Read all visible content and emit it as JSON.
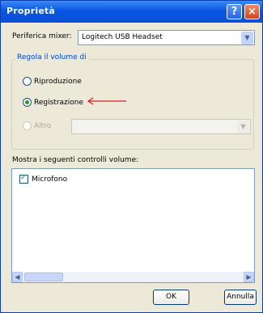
{
  "window": {
    "title": "Proprietà"
  },
  "titlebar": {
    "help_glyph": "?",
    "close_glyph": "×"
  },
  "mixer": {
    "label": "Periferica mixer:",
    "value": "Logitech USB Headset"
  },
  "volume_group": {
    "legend": "Regola il volume di",
    "options": [
      {
        "label": "Riproduzione",
        "checked": false,
        "enabled": true
      },
      {
        "label": "Registrazione",
        "checked": true,
        "enabled": true
      },
      {
        "label": "Altro",
        "checked": false,
        "enabled": false
      }
    ]
  },
  "controls": {
    "label": "Mostra i seguenti controlli volume:",
    "items": [
      {
        "label": "Microfono",
        "checked": true
      }
    ]
  },
  "buttons": {
    "ok": "OK",
    "cancel": "Annulla"
  },
  "colors": {
    "titlebar": "#0856e1",
    "annotation_arrow": "#e02020",
    "radio_checked": "#21a121"
  }
}
